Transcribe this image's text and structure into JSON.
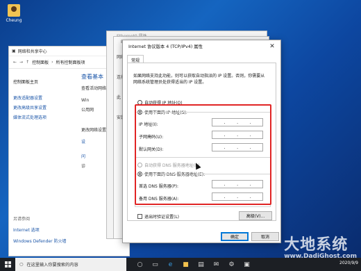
{
  "desktop": {
    "user_icon_label": "Cheung"
  },
  "control_panel": {
    "window_title": "网络和共享中心",
    "breadcrumb": [
      "控制面板",
      "所有控制面板项"
    ],
    "home_link": "控制面板主页",
    "left_links": [
      "更改适配器设置",
      "更改高级共享设置",
      "媒体流式处理选项"
    ],
    "main_heading": "查看基本",
    "main_lines": [
      "查看活动网络",
      "Win",
      "公用网",
      "更改网络设置",
      "设",
      "问",
      "诊"
    ],
    "see_also_caption": "另请参阅",
    "see_also_links": [
      "Internet 选项",
      "Windows Defender 防火墙"
    ]
  },
  "back_dialog_1": {
    "title": "Ethernet0 属性"
  },
  "back_dialog_2": {
    "title": "Ethernet0 状态",
    "side_labels": [
      "网络",
      "连接",
      "此",
      "安装"
    ]
  },
  "dialog": {
    "title": "Internet 协议版本 4 (TCP/IPv4) 属性",
    "close_glyph": "✕",
    "tab_general": "常规",
    "description": "如果网络支持此功能，则可以获取自动指派的 IP 设置。否则，你需要从网络系统管理员处获得适当的 IP 设置。",
    "radio_auto_ip": "自动获得 IP 地址(O)",
    "radio_manual_ip": "使用下面的 IP 地址(S):",
    "label_ip": "IP 地址(I):",
    "label_subnet": "子网掩码(U):",
    "label_gateway": "默认网关(D):",
    "radio_auto_dns": "自动获得 DNS 服务器地址(B)",
    "radio_manual_dns": "使用下面的 DNS 服务器地址(E):",
    "label_dns_primary": "首选 DNS 服务器(P):",
    "label_dns_alt": "备用 DNS 服务器(A):",
    "ip_dots": ".   .   .",
    "checkbox_validate": "退出时验证设置(L)",
    "btn_advanced": "高级(V)...",
    "btn_ok": "确定",
    "btn_cancel": "取消",
    "selected": {
      "ip_mode": "manual",
      "dns_mode": "manual",
      "validate_on_exit": false
    }
  },
  "taskbar": {
    "search_placeholder": "在这里输入你要搜索的内容",
    "tray_date": "2020/9/9"
  },
  "watermark": {
    "line1": "大地系统",
    "line2": "www.DadiGhost.com"
  },
  "colors": {
    "highlight": "#e02424",
    "desktop_accent": "#1565c0",
    "link": "#1a55a8"
  }
}
